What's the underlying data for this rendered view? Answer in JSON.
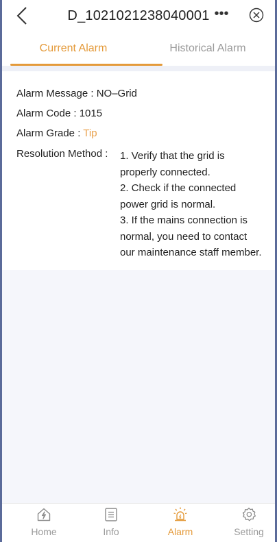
{
  "header": {
    "title": "D_1021021238040001",
    "more_label": "•••"
  },
  "tabs": [
    {
      "label": "Current Alarm",
      "active": true
    },
    {
      "label": "Historical Alarm",
      "active": false
    }
  ],
  "alarm": {
    "message_label": "Alarm Message :",
    "message_value": "NO–Grid",
    "code_label": "Alarm Code :",
    "code_value": "1015",
    "grade_label": "Alarm Grade :",
    "grade_value": "Tip",
    "resolution_label": "Resolution Method :",
    "resolution_lines": [
      "1. Verify that the grid is",
      "properly connected.",
      "2. Check if the connected",
      "power grid is normal.",
      "3. If the mains connection is",
      "normal, you need to contact",
      "our maintenance staff member."
    ]
  },
  "bottom_nav": [
    {
      "label": "Home",
      "icon": "home-icon",
      "active": false
    },
    {
      "label": "Info",
      "icon": "info-icon",
      "active": false
    },
    {
      "label": "Alarm",
      "icon": "alarm-icon",
      "active": true
    },
    {
      "label": "Setting",
      "icon": "gear-icon",
      "active": false
    }
  ],
  "colors": {
    "accent": "#e49a3a",
    "tip": "#e9a04a",
    "inactive": "#9a9a9a",
    "background_gray": "#f5f6fb"
  }
}
